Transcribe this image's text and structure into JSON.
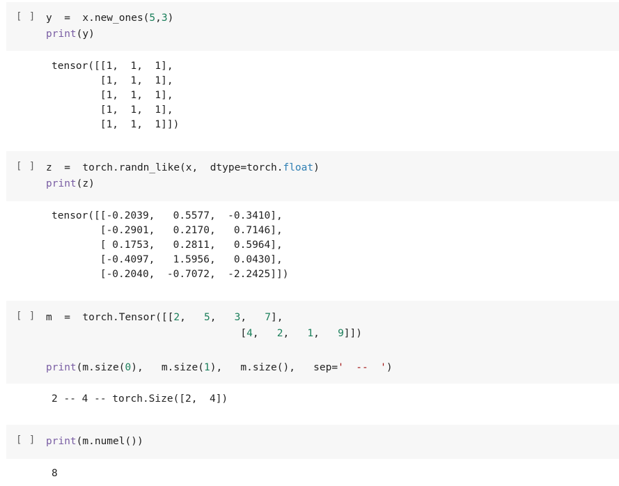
{
  "cells": [
    {
      "prompt": "[ ]",
      "code": [
        [
          {
            "t": "y  =  x.new_ones(",
            "c": "id"
          },
          {
            "t": "5",
            "c": "num"
          },
          {
            "t": ",",
            "c": "id"
          },
          {
            "t": "3",
            "c": "num"
          },
          {
            "t": ")",
            "c": "id"
          }
        ],
        [
          {
            "t": "print",
            "c": "kw"
          },
          {
            "t": "(y)",
            "c": "id"
          }
        ]
      ],
      "output": [
        "tensor([[1,  1,  1],",
        "        [1,  1,  1],",
        "        [1,  1,  1],",
        "        [1,  1,  1],",
        "        [1,  1,  1]])"
      ]
    },
    {
      "prompt": "[ ]",
      "code": [
        [
          {
            "t": "z  =  torch.randn_like(x,  dtype=torch.",
            "c": "id"
          },
          {
            "t": "float",
            "c": "fl"
          },
          {
            "t": ")",
            "c": "id"
          }
        ],
        [
          {
            "t": "print",
            "c": "kw"
          },
          {
            "t": "(z)",
            "c": "id"
          }
        ]
      ],
      "output": [
        "tensor([[-0.2039,   0.5577,  -0.3410],",
        "        [-0.2901,   0.2170,   0.7146],",
        "        [ 0.1753,   0.2811,   0.5964],",
        "        [-0.4097,   1.5956,   0.0430],",
        "        [-0.2040,  -0.7072,  -2.2425]])"
      ]
    },
    {
      "prompt": "[ ]",
      "code": [
        [
          {
            "t": "m  =  torch.Tensor([[",
            "c": "id"
          },
          {
            "t": "2",
            "c": "num"
          },
          {
            "t": ",   ",
            "c": "id"
          },
          {
            "t": "5",
            "c": "num"
          },
          {
            "t": ",   ",
            "c": "id"
          },
          {
            "t": "3",
            "c": "num"
          },
          {
            "t": ",   ",
            "c": "id"
          },
          {
            "t": "7",
            "c": "num"
          },
          {
            "t": "],",
            "c": "id"
          }
        ],
        [
          {
            "t": "                                [",
            "c": "id"
          },
          {
            "t": "4",
            "c": "num"
          },
          {
            "t": ",   ",
            "c": "id"
          },
          {
            "t": "2",
            "c": "num"
          },
          {
            "t": ",   ",
            "c": "id"
          },
          {
            "t": "1",
            "c": "num"
          },
          {
            "t": ",   ",
            "c": "id"
          },
          {
            "t": "9",
            "c": "num"
          },
          {
            "t": "]])",
            "c": "id"
          }
        ],
        [],
        [
          {
            "t": "print",
            "c": "kw"
          },
          {
            "t": "(m.size(",
            "c": "id"
          },
          {
            "t": "0",
            "c": "num"
          },
          {
            "t": "),   m.size(",
            "c": "id"
          },
          {
            "t": "1",
            "c": "num"
          },
          {
            "t": "),   m.size(),   sep=",
            "c": "id"
          },
          {
            "t": "'  --  '",
            "c": "str"
          },
          {
            "t": ")",
            "c": "id"
          }
        ]
      ],
      "output": [
        "2 -- 4 -- torch.Size([2,  4])"
      ]
    },
    {
      "prompt": "[ ]",
      "code": [
        [
          {
            "t": "print",
            "c": "kw"
          },
          {
            "t": "(m.numel())",
            "c": "id"
          }
        ]
      ],
      "output": [
        "8"
      ]
    }
  ]
}
